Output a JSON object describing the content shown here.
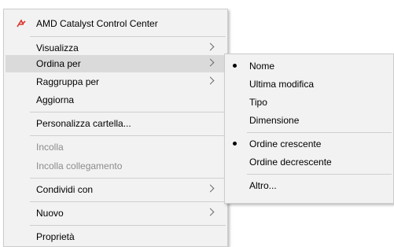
{
  "main_menu": {
    "items": [
      {
        "label": "AMD Catalyst Control Center",
        "icon": "amd-catalyst-icon"
      },
      {
        "label": "Visualizza"
      },
      {
        "label": "Ordina per"
      },
      {
        "label": "Raggruppa per"
      },
      {
        "label": "Aggiorna"
      },
      {
        "label": "Personalizza cartella..."
      },
      {
        "label": "Incolla"
      },
      {
        "label": "Incolla collegamento"
      },
      {
        "label": "Condividi con"
      },
      {
        "label": "Nuovo"
      },
      {
        "label": "Proprietà"
      }
    ]
  },
  "sort_submenu": {
    "items": [
      {
        "label": "Nome",
        "checked": true
      },
      {
        "label": "Ultima modifica",
        "checked": false
      },
      {
        "label": "Tipo",
        "checked": false
      },
      {
        "label": "Dimensione",
        "checked": false
      },
      {
        "label": "Ordine crescente",
        "checked": true
      },
      {
        "label": "Ordine decrescente",
        "checked": false
      },
      {
        "label": "Altro...",
        "checked": false
      }
    ]
  },
  "colors": {
    "menu_background": "#f2f2f2",
    "highlight": "#dadada",
    "disabled_text": "#8c8c8c",
    "amd_icon_red": "#d9342b"
  }
}
